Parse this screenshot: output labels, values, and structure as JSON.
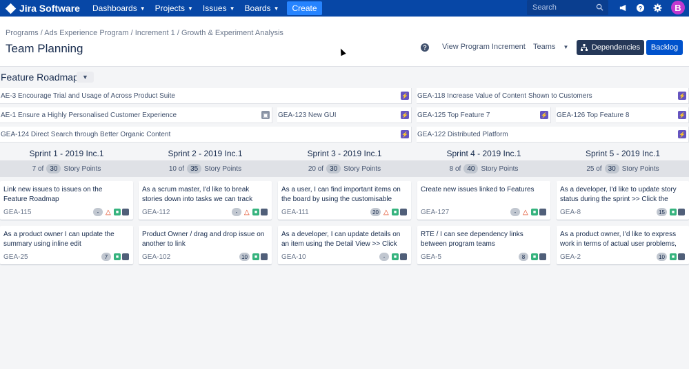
{
  "nav": {
    "brand": "Jira Software",
    "items": [
      "Dashboards",
      "Projects",
      "Issues",
      "Boards"
    ],
    "create": "Create",
    "search_placeholder": "Search"
  },
  "avatar_letter": "B",
  "header": {
    "breadcrumb": "Programs  / Ads Experience Program  / Increment 1  / Growth & Experiment Analysis",
    "title": "Team Planning",
    "view_increment": "View Program Increment",
    "teams": "Teams",
    "dependencies": "Dependencies",
    "backlog": "Backlog"
  },
  "roadmap": {
    "title": "Feature Roadmap",
    "features": [
      {
        "text": "AE-3 Encourage Trial and Usage of Across Product Suite",
        "icon": "bolt-icon"
      },
      {
        "text": "GEA-118 Increase Value of Content Shown to Customers",
        "icon": "bolt-icon"
      },
      {
        "text": "AE-1 Ensure a Highly Personalised Customer Experience",
        "icon": "box-icon"
      },
      {
        "text": "GEA-123 New GUI",
        "icon": "bolt-icon"
      },
      {
        "text": "GEA-125 Top Feature 7",
        "icon": "bolt-icon"
      },
      {
        "text": "GEA-126 Top Feature 8",
        "icon": "bolt-icon"
      },
      {
        "text": "GEA-124 Direct Search through Better Organic Content",
        "icon": "bolt-icon"
      },
      {
        "text": "GEA-122 Distributed Platform",
        "icon": "bolt-icon"
      }
    ]
  },
  "sprints": [
    {
      "name": "Sprint 1 - 2019 Inc.1",
      "done": "7 of",
      "total": "30",
      "unit": "Story Points",
      "cards": [
        {
          "text": "Link new issues to issues on the Feature Roadmap",
          "key": "GEA-115",
          "badge": "-",
          "dep": true
        },
        {
          "text": "As a product owner I can update the summary using inline edit",
          "key": "GEA-25",
          "badge": "7",
          "dep": false
        }
      ]
    },
    {
      "name": "Sprint 2 - 2019 Inc.1",
      "done": "10 of",
      "total": "35",
      "unit": "Story Points",
      "cards": [
        {
          "text": "As a scrum master, I'd like to break stories down into tasks we can track",
          "key": "GEA-112",
          "badge": "-",
          "dep": true
        },
        {
          "text": "Product Owner / drag and drop issue on another to link",
          "key": "GEA-102",
          "badge": "10",
          "dep": false
        }
      ]
    },
    {
      "name": "Sprint 3 - 2019 Inc.1",
      "done": "20 of",
      "total": "30",
      "unit": "Story Points",
      "cards": [
        {
          "text": "As a user, I can find important items on the board by using the customisable",
          "key": "GEA-111",
          "badge": "20",
          "dep": true
        },
        {
          "text": "As a developer, I can update details on an item using the Detail View >> Click",
          "key": "GEA-10",
          "badge": "-",
          "dep": false
        }
      ]
    },
    {
      "name": "Sprint 4 - 2019 Inc.1",
      "done": "8 of",
      "total": "40",
      "unit": "Story Points",
      "cards": [
        {
          "text": "Create new issues linked to Features",
          "key": "GEA-127",
          "badge": "-",
          "dep": true
        },
        {
          "text": "RTE / I can see dependency links between program teams",
          "key": "GEA-5",
          "badge": "8",
          "dep": false
        }
      ]
    },
    {
      "name": "Sprint 5 - 2019 Inc.1",
      "done": "25 of",
      "total": "30",
      "unit": "Story Points",
      "cards": [
        {
          "text": "As a developer, I'd like to update story status during the sprint >> Click the",
          "key": "GEA-8",
          "badge": "15",
          "dep": false
        },
        {
          "text": "As a product owner, I'd like to express work in terms of actual user problems,",
          "key": "GEA-2",
          "badge": "10",
          "dep": false
        }
      ]
    }
  ]
}
